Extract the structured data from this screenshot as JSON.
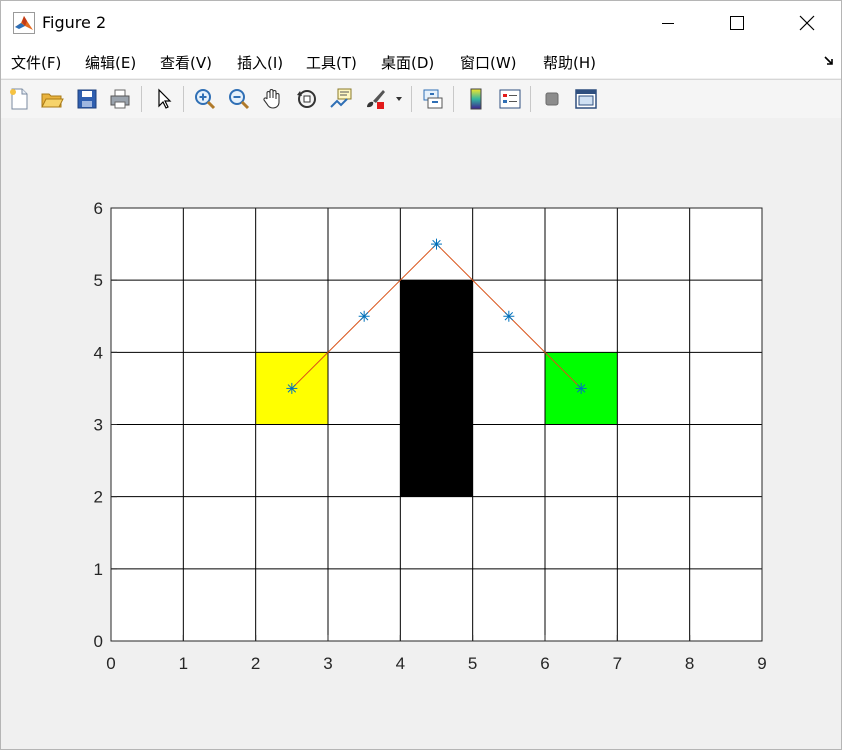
{
  "window": {
    "title": "Figure 2",
    "controls": {
      "minimize": "minimize",
      "maximize": "maximize",
      "close": "close"
    }
  },
  "menu": [
    {
      "label": "文件(F)"
    },
    {
      "label": "编辑(E)"
    },
    {
      "label": "查看(V)"
    },
    {
      "label": "插入(I)"
    },
    {
      "label": "工具(T)"
    },
    {
      "label": "桌面(D)"
    },
    {
      "label": "窗口(W)"
    },
    {
      "label": "帮助(H)"
    }
  ],
  "toolbar": [
    "new-figure-icon",
    "open-file-icon",
    "save-icon",
    "print-icon",
    "edit-plot-pointer-icon",
    "zoom-in-icon",
    "zoom-out-icon",
    "pan-hand-icon",
    "rotate-3d-icon",
    "data-cursor-icon",
    "brush-icon",
    "brush-dropdown-icon",
    "link-plot-icon",
    "colorbar-icon",
    "legend-icon",
    "hide-plot-tools-icon",
    "show-plot-tools-icon"
  ],
  "chart_data": {
    "type": "scatter",
    "xlim": [
      0,
      9
    ],
    "ylim": [
      0,
      6
    ],
    "xticks": [
      "0",
      "1",
      "2",
      "3",
      "4",
      "5",
      "6",
      "7",
      "8",
      "9"
    ],
    "yticks": [
      "0",
      "1",
      "2",
      "3",
      "4",
      "5",
      "6"
    ],
    "grid": true,
    "cells": [
      {
        "x": 2,
        "y": 3,
        "w": 1,
        "h": 1,
        "color": "#ffff00"
      },
      {
        "x": 4,
        "y": 2,
        "w": 1,
        "h": 3,
        "color": "#000000"
      },
      {
        "x": 6,
        "y": 3,
        "w": 1,
        "h": 1,
        "color": "#00ff00"
      }
    ],
    "path": {
      "color": "#d95319",
      "points": [
        [
          2.5,
          3.5
        ],
        [
          3.5,
          4.5
        ],
        [
          4.5,
          5.5
        ],
        [
          5.5,
          4.5
        ],
        [
          6.5,
          3.5
        ]
      ]
    },
    "markers": {
      "symbol": "*",
      "color": "#0072bd",
      "points": [
        [
          2.5,
          3.5
        ],
        [
          3.5,
          4.5
        ],
        [
          4.5,
          5.5
        ],
        [
          5.5,
          4.5
        ],
        [
          6.5,
          3.5
        ]
      ]
    }
  }
}
